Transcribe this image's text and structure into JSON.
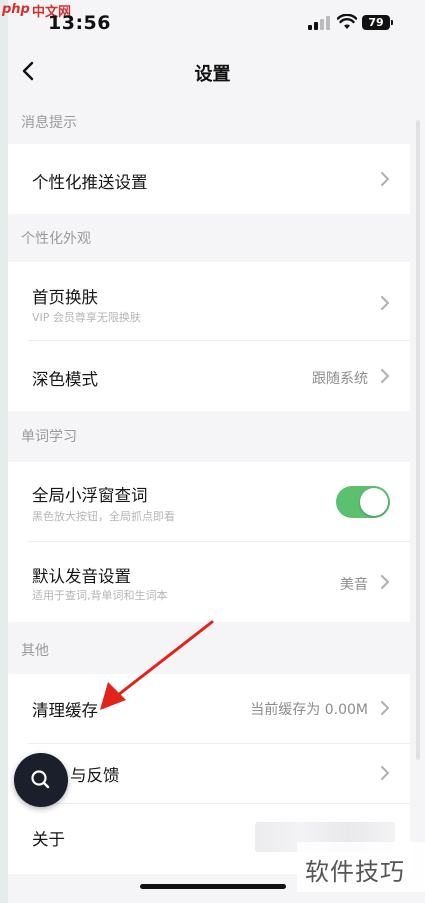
{
  "status_bar": {
    "brand_logo": "php",
    "brand_site": "中文网",
    "time": "13:56",
    "battery": "79"
  },
  "nav": {
    "title": "设置"
  },
  "sections": {
    "notifications": {
      "header": "消息提示",
      "push_settings": {
        "label": "个性化推送设置"
      }
    },
    "appearance": {
      "header": "个性化外观",
      "skin": {
        "label": "首页换肤",
        "sub": "VIP 会员尊享无限换肤"
      },
      "dark_mode": {
        "label": "深色模式",
        "value": "跟随系统"
      }
    },
    "word_learning": {
      "header": "单词学习",
      "floating_lookup": {
        "label": "全局小浮窗查词",
        "sub": "黑色放大按钮，全局抓点即看",
        "enabled": true
      },
      "pronunciation": {
        "label": "默认发音设置",
        "sub": "适用于查词,背单词和生词本",
        "value": "美音"
      }
    },
    "other": {
      "header": "其他",
      "clear_cache": {
        "label": "清理缓存",
        "value": "当前缓存为 0.00M"
      },
      "feedback": {
        "label": "与反馈"
      },
      "about": {
        "label": "关于"
      }
    }
  },
  "watermark": "软件技巧",
  "colors": {
    "toggle_on": "#5cc071",
    "annotation_arrow": "#e2231a",
    "fab_bg": "#1b1e2b"
  }
}
